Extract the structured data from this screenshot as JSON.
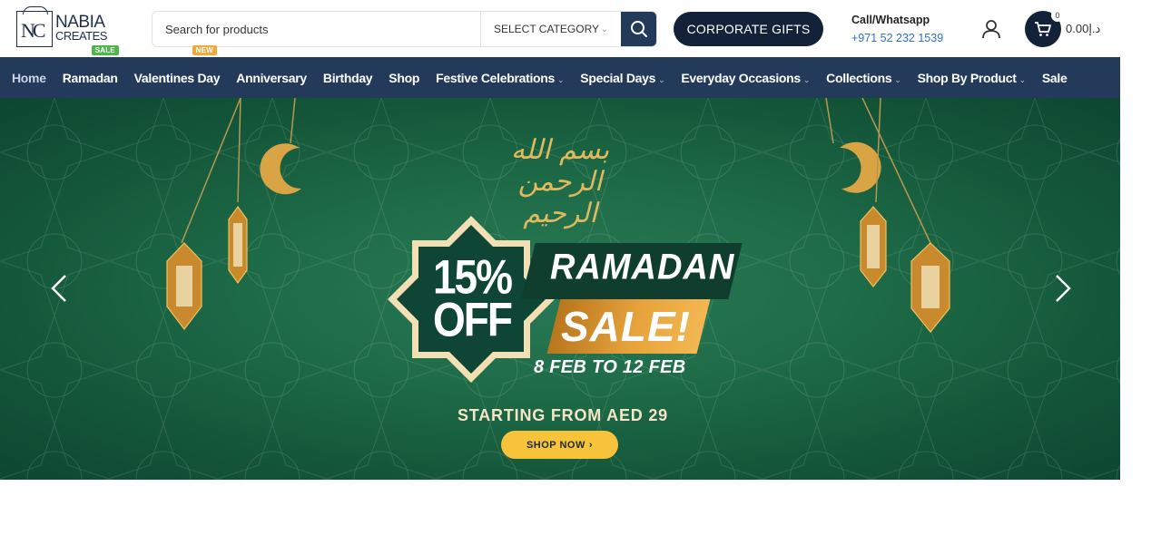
{
  "brand": {
    "line1": "NABIA",
    "line2": "CREATES",
    "mark": "NC"
  },
  "search": {
    "placeholder": "Search for products",
    "category": "SELECT CATEGORY"
  },
  "header": {
    "corporate_label": "CORPORATE GIFTS",
    "contact_label": "Call/Whatsapp",
    "contact_number": "+971 52 232 1539",
    "cart_count": "0",
    "cart_total": "0.00د.إ"
  },
  "nav": {
    "items": [
      {
        "label": "Home"
      },
      {
        "label": "Ramadan",
        "badge": "SALE"
      },
      {
        "label": "Valentines Day",
        "badge": "NEW"
      },
      {
        "label": "Anniversary"
      },
      {
        "label": "Birthday"
      },
      {
        "label": "Shop"
      },
      {
        "label": "Festive Celebrations"
      },
      {
        "label": "Special Days"
      },
      {
        "label": "Everyday Occasions"
      },
      {
        "label": "Collections"
      },
      {
        "label": "Shop By Product"
      },
      {
        "label": "Sale"
      }
    ]
  },
  "banner": {
    "calligraphy": "بسم الله الرحمن الرحيم",
    "pct_line1": "15%",
    "pct_line2": "OFF",
    "headline": "RAMADAN",
    "subhead": "SALE!",
    "dates": "8 FEB TO 12 FEB",
    "starting": "STARTING FROM AED 29",
    "cta": "SHOP NOW"
  },
  "colors": {
    "navy": "#243a5b",
    "dark_navy": "#132238",
    "banner_green": "#1d6a47",
    "gold": "#e7a33c",
    "cta_yellow": "#f7c33a",
    "sale_badge": "#4db848",
    "new_badge": "#f2a93b",
    "link_blue": "#2e6fc9"
  },
  "icons": [
    "search-icon",
    "user-icon",
    "cart-icon",
    "chevron-left-icon",
    "chevron-right-icon",
    "crescent-icon",
    "lantern-icon"
  ]
}
